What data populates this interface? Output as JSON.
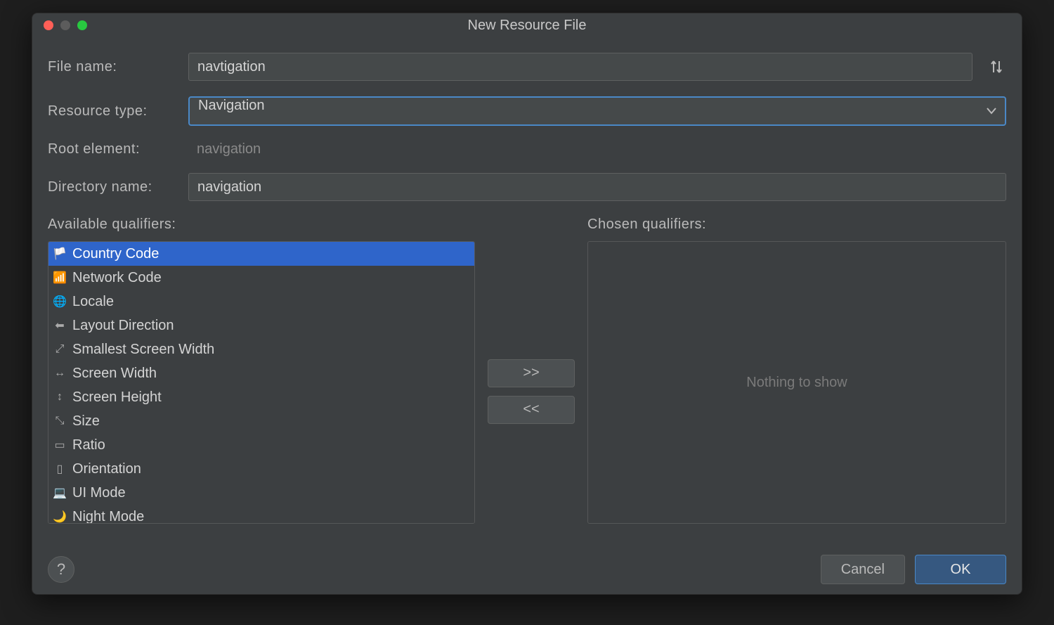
{
  "dialog": {
    "title": "New Resource File",
    "labels": {
      "file_name": "File name:",
      "resource_type": "Resource type:",
      "root_element": "Root element:",
      "directory_name": "Directory name:",
      "available_qualifiers": "Available qualifiers:",
      "chosen_qualifiers": "Chosen qualifiers:"
    },
    "fields": {
      "file_name": "navtigation",
      "resource_type": "Navigation",
      "root_element": "navigation",
      "directory_name": "navigation"
    },
    "transfer": {
      "add": ">>",
      "remove": "<<"
    },
    "available_qualifiers": [
      {
        "label": "Country Code",
        "icon": "country-code-icon",
        "selected": true
      },
      {
        "label": "Network Code",
        "icon": "network-code-icon",
        "selected": false
      },
      {
        "label": "Locale",
        "icon": "globe-icon",
        "selected": false
      },
      {
        "label": "Layout Direction",
        "icon": "arrow-left-icon",
        "selected": false
      },
      {
        "label": "Smallest Screen Width",
        "icon": "expand-icon",
        "selected": false
      },
      {
        "label": "Screen Width",
        "icon": "width-icon",
        "selected": false
      },
      {
        "label": "Screen Height",
        "icon": "height-icon",
        "selected": false
      },
      {
        "label": "Size",
        "icon": "resize-icon",
        "selected": false
      },
      {
        "label": "Ratio",
        "icon": "ratio-icon",
        "selected": false
      },
      {
        "label": "Orientation",
        "icon": "orientation-icon",
        "selected": false
      },
      {
        "label": "UI Mode",
        "icon": "ui-mode-icon",
        "selected": false
      },
      {
        "label": "Night Mode",
        "icon": "night-mode-icon",
        "selected": false
      }
    ],
    "chosen_empty_text": "Nothing to show",
    "buttons": {
      "help": "?",
      "cancel": "Cancel",
      "ok": "OK"
    }
  }
}
